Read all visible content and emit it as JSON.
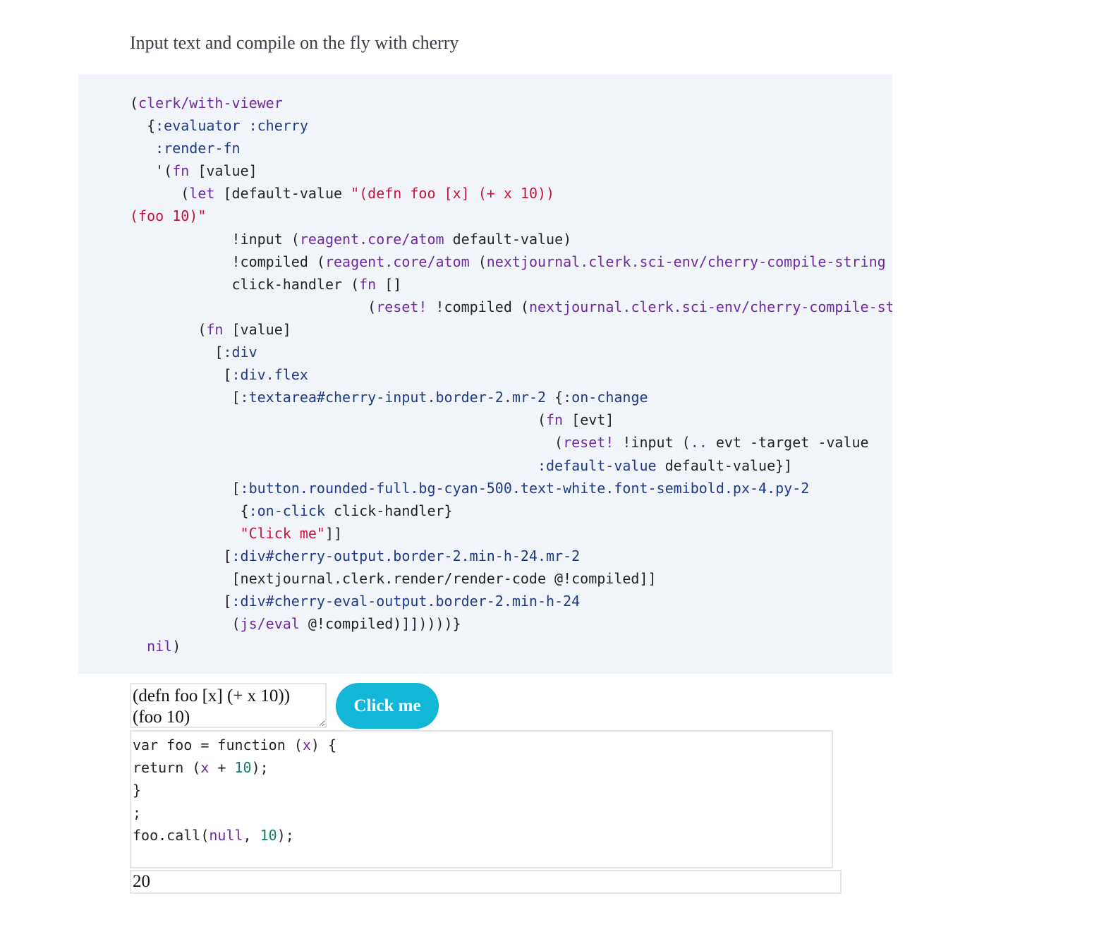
{
  "intro_text": "Input text and compile on the fly with cherry",
  "colors": {
    "code_bg": "#f1f4f9",
    "symbol": "#6f2aa3",
    "keyword": "#1e3b84",
    "string": "#c2153d",
    "number": "#0f7f6a",
    "button_bg": "#12b6d6"
  },
  "source_code": {
    "lines": [
      [
        {
          "t": "(",
          "c": ""
        },
        {
          "t": "clerk/with-viewer",
          "c": "pu"
        }
      ],
      [
        {
          "t": "  {",
          "c": ""
        },
        {
          "t": ":evaluator",
          "c": "bl"
        },
        {
          "t": " ",
          "c": ""
        },
        {
          "t": ":cherry",
          "c": "bl"
        }
      ],
      [
        {
          "t": "   ",
          "c": ""
        },
        {
          "t": ":render-fn",
          "c": "bl"
        }
      ],
      [
        {
          "t": "   '(",
          "c": ""
        },
        {
          "t": "fn",
          "c": "pu"
        },
        {
          "t": " [value]",
          "c": ""
        }
      ],
      [
        {
          "t": "      (",
          "c": ""
        },
        {
          "t": "let",
          "c": "pu"
        },
        {
          "t": " [default-value ",
          "c": ""
        },
        {
          "t": "\"(defn foo [x] (+ x 10))",
          "c": "rd"
        }
      ],
      [
        {
          "t": "(foo 10)\"",
          "c": "rd"
        }
      ],
      [
        {
          "t": "            !input (",
          "c": ""
        },
        {
          "t": "reagent.core/atom",
          "c": "pu"
        },
        {
          "t": " default-value)",
          "c": ""
        }
      ],
      [
        {
          "t": "            !compiled (",
          "c": ""
        },
        {
          "t": "reagent.core/atom",
          "c": "pu"
        },
        {
          "t": " (",
          "c": ""
        },
        {
          "t": "nextjournal.clerk.sci-env/cherry-compile-string",
          "c": "pu"
        }
      ],
      [
        {
          "t": "            click-handler (",
          "c": ""
        },
        {
          "t": "fn",
          "c": "pu"
        },
        {
          "t": " []",
          "c": ""
        }
      ],
      [
        {
          "t": "                            (",
          "c": ""
        },
        {
          "t": "reset!",
          "c": "pu"
        },
        {
          "t": " !compiled (",
          "c": ""
        },
        {
          "t": "nextjournal.clerk.sci-env/cherry-compile-st",
          "c": "pu"
        }
      ],
      [
        {
          "t": "        (",
          "c": ""
        },
        {
          "t": "fn",
          "c": "pu"
        },
        {
          "t": " [value]",
          "c": ""
        }
      ],
      [
        {
          "t": "          [",
          "c": ""
        },
        {
          "t": ":div",
          "c": "bl"
        }
      ],
      [
        {
          "t": "           [",
          "c": ""
        },
        {
          "t": ":div.flex",
          "c": "bl"
        }
      ],
      [
        {
          "t": "            [",
          "c": ""
        },
        {
          "t": ":textarea#cherry-input.border-2.mr-2",
          "c": "bl"
        },
        {
          "t": " {",
          "c": ""
        },
        {
          "t": ":on-change",
          "c": "bl"
        }
      ],
      [
        {
          "t": "                                                (",
          "c": ""
        },
        {
          "t": "fn",
          "c": "pu"
        },
        {
          "t": " [evt]",
          "c": ""
        }
      ],
      [
        {
          "t": "                                                  (",
          "c": ""
        },
        {
          "t": "reset!",
          "c": "pu"
        },
        {
          "t": " !input (",
          "c": ""
        },
        {
          "t": "..",
          "c": "pu"
        },
        {
          "t": " evt -target -value",
          "c": ""
        }
      ],
      [
        {
          "t": "                                                ",
          "c": ""
        },
        {
          "t": ":default-value",
          "c": "bl"
        },
        {
          "t": " default-value}]",
          "c": ""
        }
      ],
      [
        {
          "t": "            [",
          "c": ""
        },
        {
          "t": ":button.rounded-full.bg-cyan-500.text-white.font-semibold.px-4.py-2",
          "c": "bl"
        }
      ],
      [
        {
          "t": "             {",
          "c": ""
        },
        {
          "t": ":on-click",
          "c": "bl"
        },
        {
          "t": " click-handler}",
          "c": ""
        }
      ],
      [
        {
          "t": "             ",
          "c": ""
        },
        {
          "t": "\"Click me\"",
          "c": "rd"
        },
        {
          "t": "]]",
          "c": ""
        }
      ],
      [
        {
          "t": "           [",
          "c": ""
        },
        {
          "t": ":div#cherry-output.border-2.min-h-24.mr-2",
          "c": "bl"
        }
      ],
      [
        {
          "t": "            [nextjournal.clerk.render/render-code @!compiled]]",
          "c": ""
        }
      ],
      [
        {
          "t": "           [",
          "c": ""
        },
        {
          "t": ":div#cherry-eval-output.border-2.min-h-24",
          "c": "bl"
        }
      ],
      [
        {
          "t": "            (",
          "c": ""
        },
        {
          "t": "js/eval",
          "c": "pu"
        },
        {
          "t": " @!compiled)]]))))}",
          "c": ""
        }
      ],
      [
        {
          "t": "  ",
          "c": ""
        },
        {
          "t": "nil",
          "c": "pu"
        },
        {
          "t": ")",
          "c": ""
        }
      ]
    ]
  },
  "cherry_input": {
    "value": "(defn foo [x] (+ x 10))\n(foo 10)"
  },
  "click_button": {
    "label": "Click me"
  },
  "compiled_output": {
    "lines": [
      [
        {
          "t": "var foo = function (",
          "c": ""
        },
        {
          "t": "x",
          "c": "pu"
        },
        {
          "t": ") {",
          "c": ""
        }
      ],
      [
        {
          "t": "return (",
          "c": ""
        },
        {
          "t": "x",
          "c": "pu"
        },
        {
          "t": " + ",
          "c": ""
        },
        {
          "t": "10",
          "c": "gr"
        },
        {
          "t": ");",
          "c": ""
        }
      ],
      [
        {
          "t": "}",
          "c": ""
        }
      ],
      [
        {
          "t": ";",
          "c": ""
        }
      ],
      [
        {
          "t": "foo.call(",
          "c": ""
        },
        {
          "t": "null",
          "c": "pu"
        },
        {
          "t": ", ",
          "c": ""
        },
        {
          "t": "10",
          "c": "gr"
        },
        {
          "t": ");",
          "c": ""
        }
      ]
    ]
  },
  "eval_output": {
    "value": "20"
  }
}
